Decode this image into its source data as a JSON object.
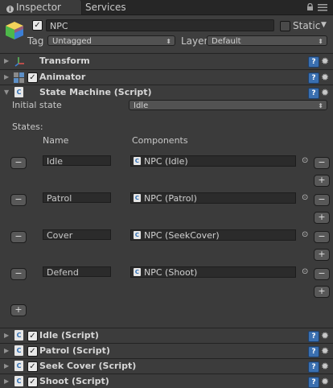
{
  "tabs": [
    {
      "label": "Inspector",
      "active": true
    },
    {
      "label": "Services",
      "active": false
    }
  ],
  "window_icons": {
    "lock": "lock-icon",
    "menu": "menu-icon"
  },
  "object": {
    "name": "NPC",
    "active": true,
    "static_label": "Static",
    "static": false,
    "tag_label": "Tag",
    "tag_value": "Untagged",
    "layer_label": "Layer",
    "layer_value": "Default"
  },
  "components_top": [
    {
      "name": "Transform",
      "icon": "transform-axes-icon",
      "has_checkbox": false
    },
    {
      "name": "Animator",
      "icon": "animator-icon",
      "has_checkbox": true,
      "enabled": true
    }
  ],
  "state_machine": {
    "title": "State Machine (Script)",
    "initial_state_label": "Initial state",
    "initial_state_value": "Idle",
    "states_label": "States:",
    "col_name": "Name",
    "col_components": "Components",
    "states": [
      {
        "name": "Idle",
        "component": "NPC (Idle)"
      },
      {
        "name": "Patrol",
        "component": "NPC (Patrol)"
      },
      {
        "name": "Cover",
        "component": "NPC (SeekCover)"
      },
      {
        "name": "Defend",
        "component": "NPC (Shoot)"
      }
    ],
    "minus": "−",
    "plus": "+"
  },
  "components_bottom": [
    {
      "name": "Idle (Script)",
      "enabled": true
    },
    {
      "name": "Patrol (Script)",
      "enabled": true
    },
    {
      "name": "Seek Cover (Script)",
      "enabled": true
    },
    {
      "name": "Shoot (Script)",
      "enabled": true
    }
  ],
  "colors": {
    "background": "#3b3b3b",
    "help_icon": "#3a6fb0"
  }
}
